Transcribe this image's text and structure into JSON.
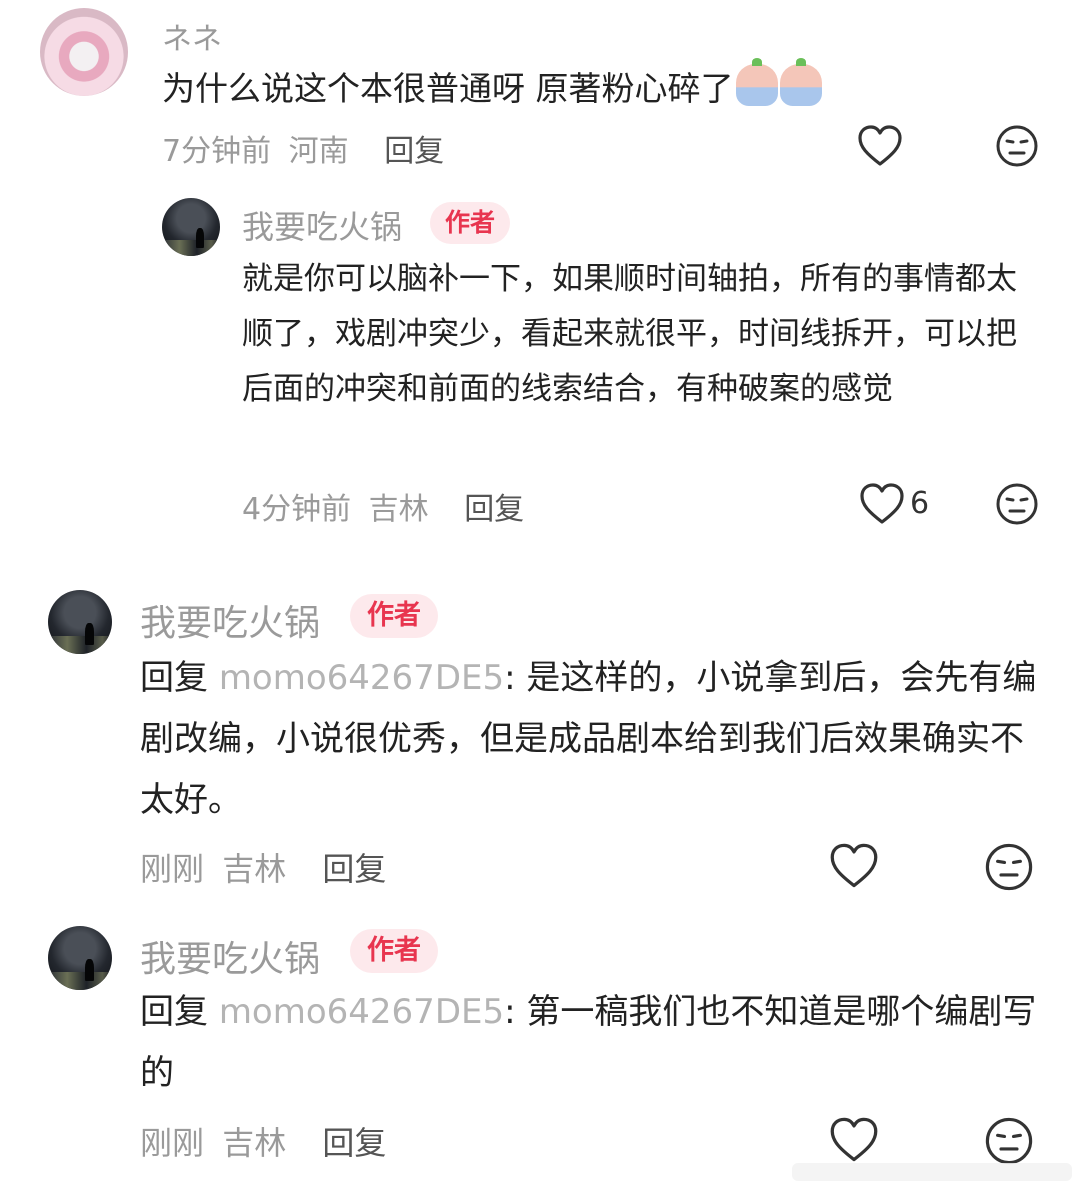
{
  "comments": [
    {
      "name": "ネネ",
      "text": "为什么说这个本很普通呀 原著粉心碎了",
      "emoji_icons": [
        "crying-emoji-icon",
        "crying-emoji-icon"
      ],
      "time": "7分钟前",
      "location": "河南",
      "reply_label": "回复",
      "likes": ""
    },
    {
      "name": "我要吃火锅",
      "badge": "作者",
      "text": "就是你可以脑补一下，如果顺时间轴拍，所有的事情都太顺了，戏剧冲突少，看起来就很平，时间线拆开，可以把后面的冲突和前面的线索结合，有种破案的感觉",
      "time": "4分钟前",
      "location": "吉林",
      "reply_label": "回复",
      "likes": "6"
    },
    {
      "name": "我要吃火锅",
      "badge": "作者",
      "reply_prefix": "回复",
      "mention": "momo64267DE5",
      "text": ": 是这样的，小说拿到后，会先有编剧改编，小说很优秀，但是成品剧本给到我们后效果确实不太好。",
      "time": "刚刚",
      "location": "吉林",
      "reply_label": "回复",
      "likes": ""
    },
    {
      "name": "我要吃火锅",
      "badge": "作者",
      "reply_prefix": "回复",
      "mention": "momo64267DE5",
      "text": ": 第一稿我们也不知道是哪个编剧写的",
      "time": "刚刚",
      "location": "吉林",
      "reply_label": "回复",
      "likes": ""
    }
  ],
  "colors": {
    "author_badge_bg": "#fde9ec",
    "author_badge_text": "#e8354f",
    "meta_text": "#9a9a9a",
    "mention": "#b4b4b4"
  },
  "icons": [
    "heart-icon",
    "dislike-face-icon"
  ]
}
